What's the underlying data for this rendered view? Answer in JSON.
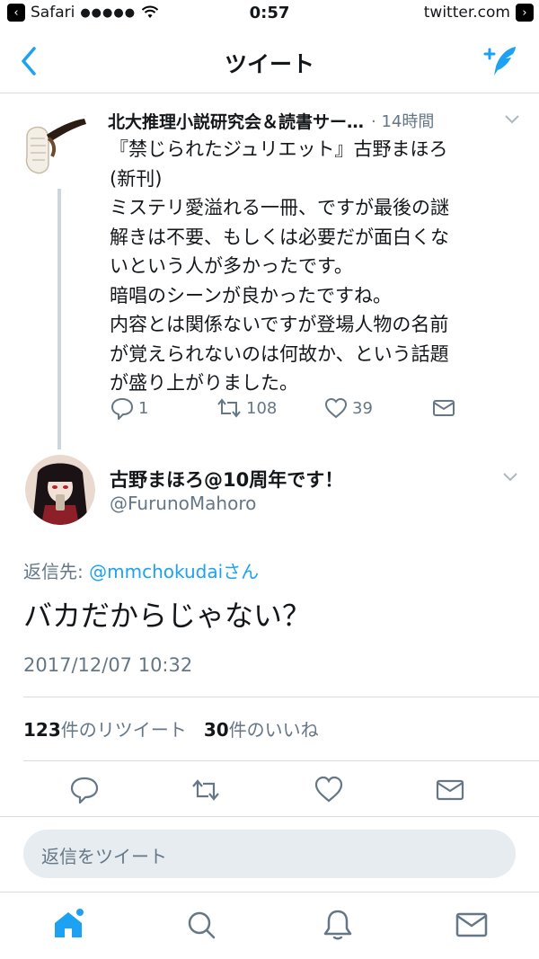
{
  "status_bar": {
    "carrier": "Safari",
    "signal": "●●●●●",
    "time": "0:57",
    "url": "twitter.com"
  },
  "nav": {
    "title": "ツイート"
  },
  "parent_tweet": {
    "author_name": "北大推理小説研究会＆読書サー…",
    "time": "· 14時間",
    "text": "『禁じられたジュリエット』古野まほろ\n(新刊)\nミステリ愛溢れる一冊、ですが最後の謎\n解きは不要、もしくは必要だが面白くな\nいという人が多かったです。\n暗唱のシーンが良かったですね。\n内容とは関係ないですが登場人物の名前\nが覚えられないのは何故か、という話題\nが盛り上がりました。",
    "replies": "1",
    "retweets": "108",
    "likes": "39"
  },
  "main_tweet": {
    "display_name": "古野まほろ@10周年です！",
    "handle": "@FurunoMahoro",
    "reply_prefix": "返信先: ",
    "reply_mention": "@mmchokudai",
    "reply_suffix": "さん",
    "text": "バカだからじゃない？",
    "datetime": "2017/12/07 10:32",
    "retweet_count": "123",
    "retweet_label": "件のリツイート",
    "like_count": "30",
    "like_label": "件のいいね"
  },
  "reply_input": {
    "placeholder": "返信をツイート"
  },
  "colors": {
    "accent": "#1da1f2",
    "muted": "#657786",
    "divider": "#d6dbe0"
  },
  "icons": {
    "nav_back": "chevron-left-icon",
    "compose": "compose-tweet-icon",
    "reply": "reply-icon",
    "retweet": "retweet-icon",
    "like": "heart-icon",
    "dm": "envelope-icon",
    "home": "home-icon",
    "search": "search-icon",
    "notifications": "bell-icon",
    "messages": "envelope-icon"
  }
}
